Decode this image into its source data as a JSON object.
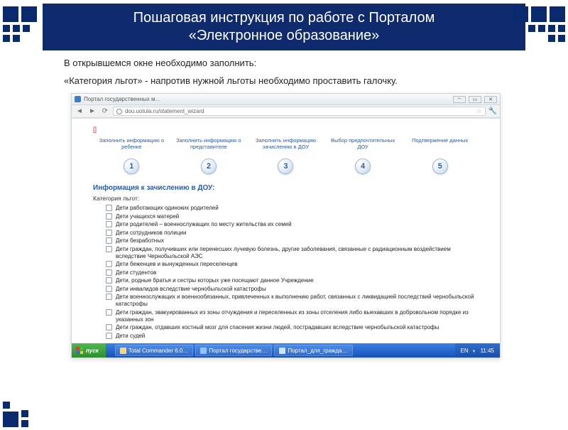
{
  "slide": {
    "title_line1": "Пошаговая инструкция по работе с Порталом",
    "title_line2": "«Электронное образование»",
    "intro1": "В открывшемся окне необходимо заполнить:",
    "intro2": "«Категория льгот» - напротив нужной льготы необходимо проставить галочку."
  },
  "browser": {
    "tab_title": "Портал государственных м…",
    "url": "dou.uotula.ru/statement_wizard",
    "error_marker": "[]"
  },
  "steps": [
    {
      "num": "1",
      "label": "Заполнить информацию о ребенке"
    },
    {
      "num": "2",
      "label": "Заполнить информацию о представителе"
    },
    {
      "num": "3",
      "label": "Заполнить информацию зачислению в ДОУ"
    },
    {
      "num": "4",
      "label": "Выбор предпочтительных ДОУ"
    },
    {
      "num": "5",
      "label": "Подтвержение данных"
    }
  ],
  "form": {
    "section_title": "Информация к зачислению в ДОУ:",
    "field_label": "Категория льгот:",
    "checkboxes": [
      "Дети работающих одиноких родителей",
      "Дети учащихся матерей",
      "Дети родителей – военнослужащих по месту жительства их семей",
      "Дети сотрудников полиции",
      "Дети безработных",
      "Дети граждан, получивших или перенесших лучевую болезнь, другие заболевания, связанные с радиационным воздействием вследствие Чернобыльской АЭС",
      "Дети беженцев и вынужденных переселенцев",
      "Дети студентов",
      "Дети, родные братья и сестры которых уже посещают данное Учреждение",
      "Дети инвалидов вследствие чернобыльской катастрофы",
      "Дети военнослужащих и военнообязанных, привлеченных к выполнению работ, связанных с ликвидацией последствий чернобыльской катастрофы",
      "Дети граждан, эвакуированных из зоны отчуждения и переселенных из зоны отселения либо выехавших в добровольном порядке из указанных зон",
      "Дети граждан, отдавших костный мозг для спасения жизни людей, пострадавших вследствие чернобыльской катастрофы",
      "Дети судей"
    ]
  },
  "taskbar": {
    "start": "пуск",
    "items": [
      "Total Commander 6.0…",
      "Портал государстве…",
      "Портал_для_гражда…"
    ],
    "lang": "EN",
    "time": "11:45"
  }
}
